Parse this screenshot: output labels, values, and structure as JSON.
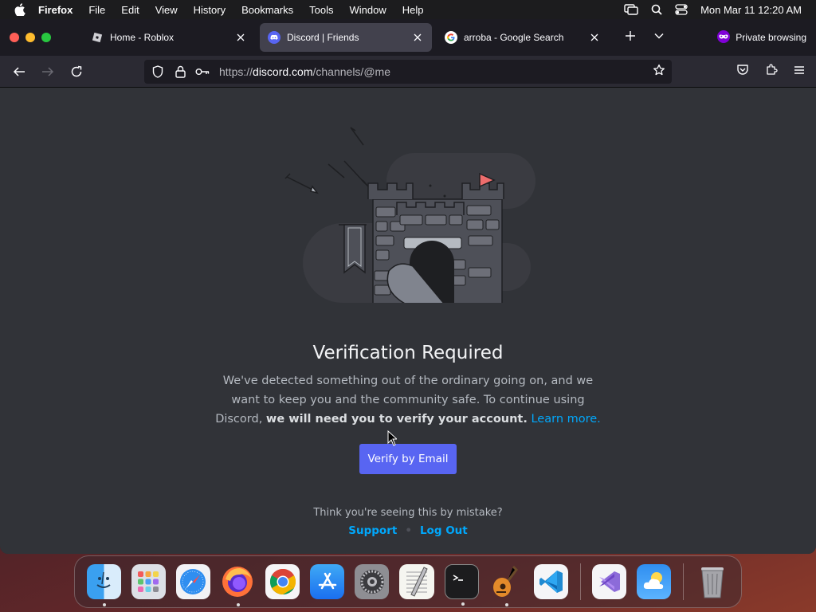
{
  "menubar": {
    "app_name": "Firefox",
    "items": [
      "File",
      "Edit",
      "View",
      "History",
      "Bookmarks",
      "Tools",
      "Window",
      "Help"
    ],
    "clock": "Mon Mar 11  12:20 AM"
  },
  "tabs": [
    {
      "label": "Home - Roblox",
      "icon": "roblox-icon",
      "active": false
    },
    {
      "label": "Discord | Friends",
      "icon": "discord-icon",
      "active": true
    },
    {
      "label": "arroba - Google Search",
      "icon": "google-icon",
      "active": false
    }
  ],
  "private_label": "Private browsing",
  "url": {
    "scheme": "https://",
    "host": "discord.com",
    "path": "/channels/@me"
  },
  "page": {
    "title": "Verification Required",
    "desc_plain": "We've detected something out of the ordinary going on, and we want to keep you and the community safe. To continue using Discord,",
    "desc_bold": "we will need you to verify your account.",
    "learn_more": "Learn more.",
    "verify_button": "Verify by Email",
    "mistake_text": "Think you're seeing this by mistake?",
    "support_link": "Support",
    "separator": "•",
    "logout_link": "Log Out"
  },
  "colors": {
    "blurple": "#5865f2",
    "link": "#00a8fc",
    "background": "#313338"
  },
  "dock": [
    "Finder",
    "Launchpad",
    "Safari",
    "Firefox",
    "Chrome",
    "App Store",
    "System Settings",
    "TextEdit",
    "Terminal",
    "GarageBand",
    "Visual Studio Code",
    "Visual Studio",
    "Weather",
    "Trash"
  ]
}
